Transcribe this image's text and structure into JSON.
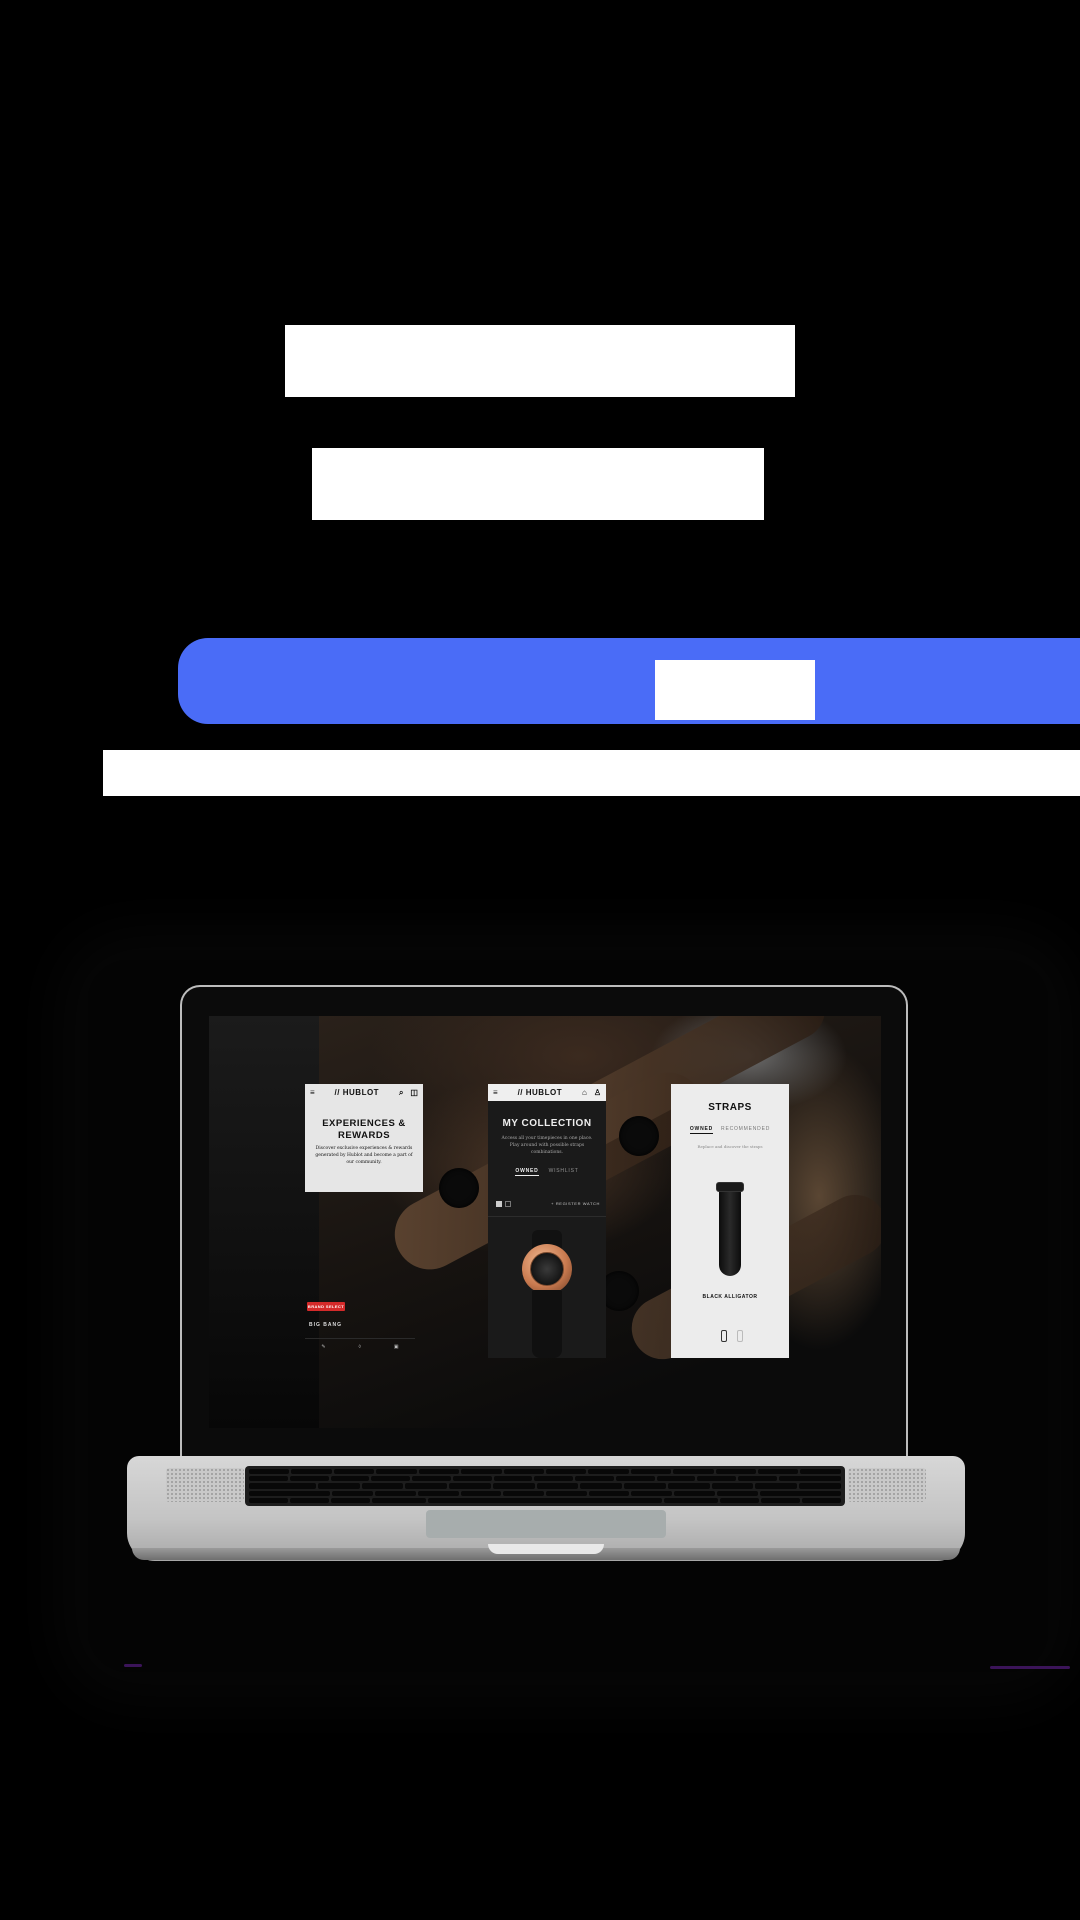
{
  "laptop_screen": {
    "card_left": {
      "brand": "HUBLOT",
      "title": "EXPERIENCES & REWARDS",
      "text": "Discover exclusive experiences & rewards generated by Hublot and become a part of our community.",
      "badge": "BRAND SELECT",
      "model": "BIG BANG"
    },
    "card_center": {
      "brand": "HUBLOT",
      "title": "MY COLLECTION",
      "text": "Access all your timepieces in one place. Play around with possible straps combinations.",
      "tab_active": "OWNED",
      "tab_inactive": "WISHLIST",
      "register_label": "REGISTER WATCH"
    },
    "card_right": {
      "title": "STRAPS",
      "tab_active": "OWNED",
      "tab_inactive": "RECOMMENDED",
      "subtitle": "Replace and discover the straps",
      "strap_name": "BLACK ALLIGATOR"
    }
  },
  "colors": {
    "accent_mask": "#4a6cf7",
    "badge_red": "#d42a2a"
  }
}
